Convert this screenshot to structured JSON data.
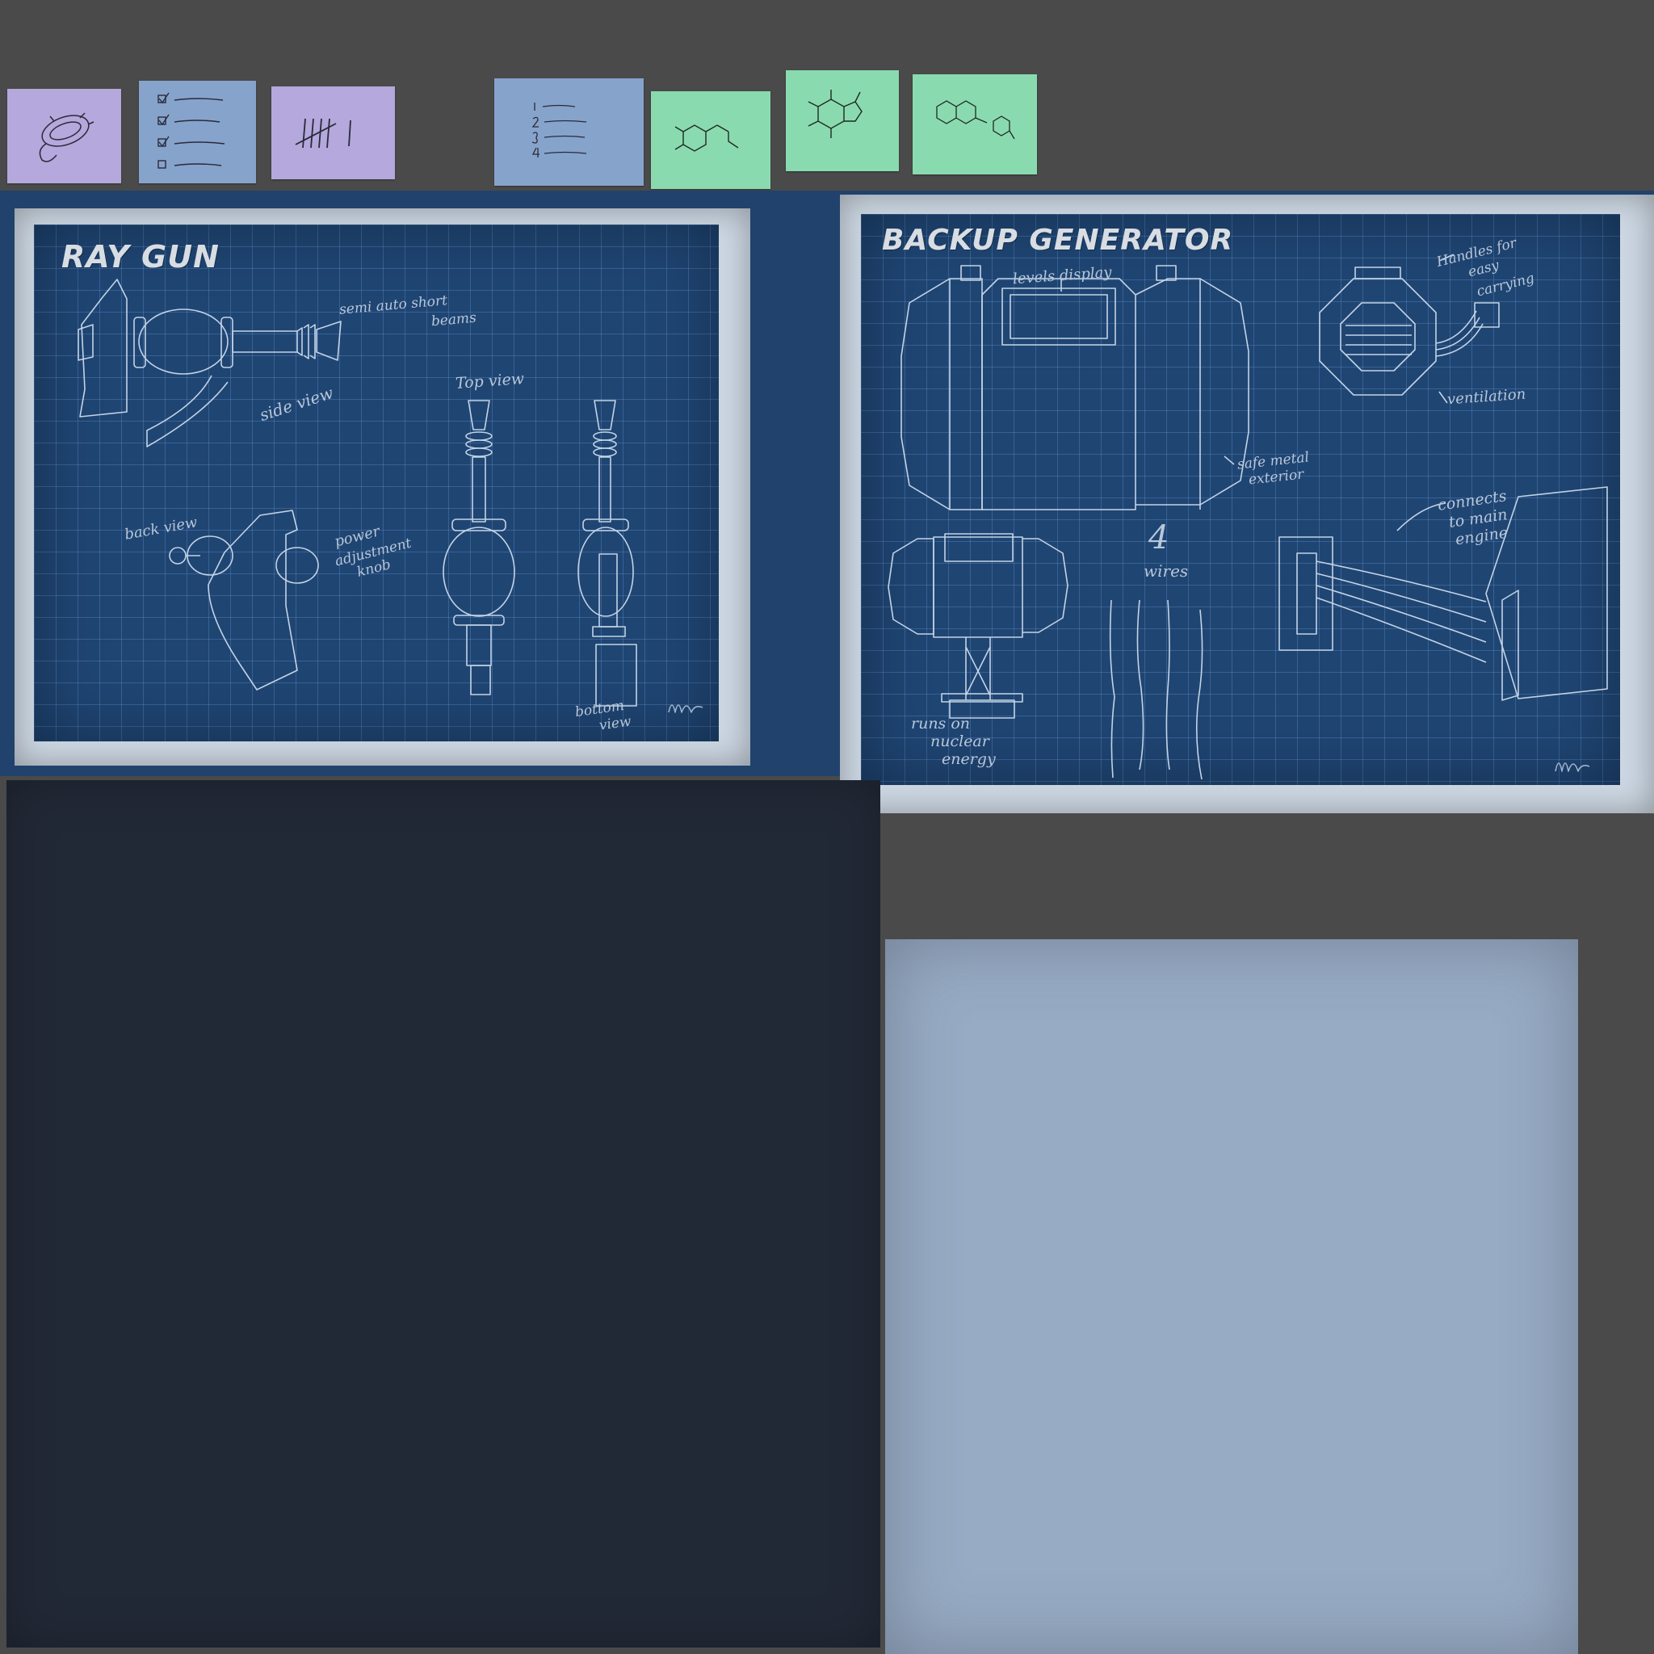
{
  "colors": {
    "background": "#4a4a4a",
    "blueprint_band": "#20426c",
    "blueprint_fill": "#1f4573",
    "card_border": "#cdd8e4",
    "note_purple": "#b4a8dc",
    "note_blue": "#86a3cb",
    "note_green": "#8adab0",
    "dark_panel": "#222936",
    "light_panel": "#97abc4"
  },
  "sticky_notes": [
    {
      "color": "purple",
      "icon": "bacterium-doodle-icon"
    },
    {
      "color": "blue",
      "icon": "checklist-icon"
    },
    {
      "color": "purple",
      "icon": "tally-marks-icon"
    },
    {
      "color": "blue",
      "icon": "numbered-list-icon"
    },
    {
      "color": "green",
      "icon": "dopamine-molecule-icon"
    },
    {
      "color": "green",
      "icon": "caffeine-molecule-icon"
    },
    {
      "color": "green",
      "icon": "flavonoid-molecule-icon"
    }
  ],
  "ray_gun": {
    "title": "RAY GUN",
    "annotations": {
      "semi_auto_1": "semi auto short",
      "semi_auto_2": "beams",
      "side_view": "side view",
      "top_view": "Top view",
      "back_view": "back view",
      "power_1": "power",
      "power_2": "adjustment",
      "power_3": "knob",
      "bottom_1": "bottom",
      "bottom_2": "view"
    }
  },
  "generator": {
    "title": "BACKUP GENERATOR",
    "annotations": {
      "levels_display": "levels display",
      "handles_1": "Handles for",
      "handles_2": "easy",
      "handles_3": "carrying",
      "ventilation": "ventilation",
      "safe_1": "safe metal",
      "safe_2": "exterior",
      "wires_count": "4",
      "wires_label": "wires",
      "connects_1": "connects",
      "connects_2": "to main",
      "connects_3": "engine",
      "runs_1": "runs on",
      "runs_2": "nuclear",
      "runs_3": "energy"
    }
  }
}
